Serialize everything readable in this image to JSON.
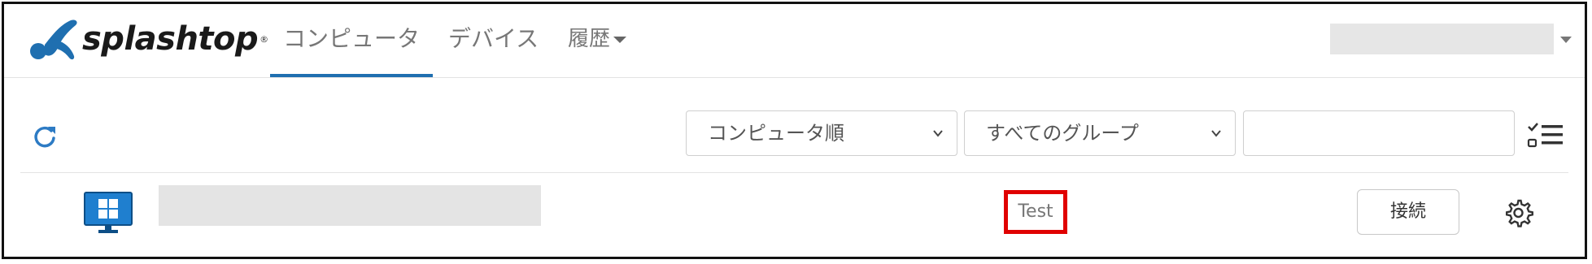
{
  "brand": {
    "name": "splashtop",
    "registered_mark": "®"
  },
  "nav": {
    "tabs": [
      {
        "label": "コンピュータ",
        "active": true
      },
      {
        "label": "デバイス",
        "active": false
      },
      {
        "label": "履歴",
        "active": false,
        "has_dropdown": true
      }
    ]
  },
  "toolbar": {
    "refresh_icon": "refresh-icon",
    "sort_select": {
      "value": "コンピュータ順"
    },
    "group_select": {
      "value": "すべてのグループ"
    },
    "search": {
      "value": "",
      "placeholder": ""
    },
    "multi_select_icon": "checklist-icon"
  },
  "computers": [
    {
      "os_icon": "windows-monitor-icon",
      "tag": "Test",
      "connect_label": "接続",
      "settings_icon": "gear-icon"
    }
  ],
  "colors": {
    "accent": "#1f6fb0",
    "logo_blue": "#1f6fb0",
    "highlight_border": "#e00000"
  }
}
